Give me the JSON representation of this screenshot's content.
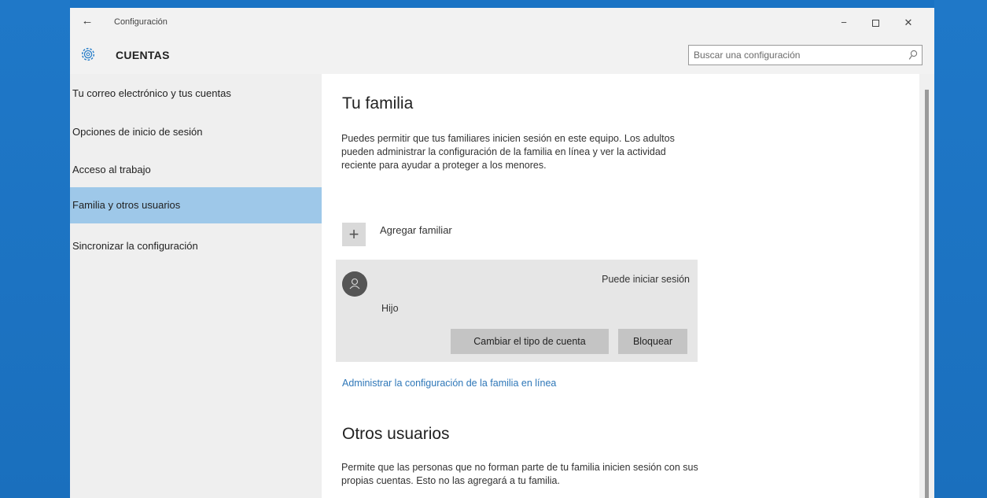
{
  "window": {
    "title": "Configuración",
    "minimize": "−",
    "close": "✕"
  },
  "header": {
    "section_title": "CUENTAS",
    "search_placeholder": "Buscar una configuración"
  },
  "sidebar": {
    "items": [
      {
        "label": "Tu correo electrónico y tus cuentas",
        "active": false
      },
      {
        "label": "Opciones de inicio de sesión",
        "active": false
      },
      {
        "label": "Acceso al trabajo",
        "active": false
      },
      {
        "label": "Familia y otros usuarios",
        "active": true
      },
      {
        "label": "Sincronizar la configuración",
        "active": false
      }
    ]
  },
  "family": {
    "heading": "Tu familia",
    "description": "Puedes permitir que tus familiares inicien sesión en este equipo. Los adultos pueden administrar la configuración de la familia en línea y ver la actividad reciente para ayudar a proteger a los menores.",
    "add_label": "Agregar familiar",
    "member": {
      "role": "Hijo",
      "status": "Puede iniciar sesión",
      "change_type_label": "Cambiar el tipo de cuenta",
      "block_label": "Bloquear"
    },
    "manage_link": "Administrar la configuración de la familia en línea"
  },
  "others": {
    "heading": "Otros usuarios",
    "description": "Permite que las personas que no forman parte de tu familia inicien sesión con sus propias cuentas. Esto no las agregará a tu familia."
  },
  "colors": {
    "accent": "#9ec8e9",
    "link": "#2e77b8",
    "desktop": "#1a73c4"
  },
  "icons": {
    "back": "back-arrow-icon",
    "settings": "gear-icon",
    "search": "search-icon",
    "add": "plus-icon",
    "avatar": "user-avatar-icon"
  }
}
